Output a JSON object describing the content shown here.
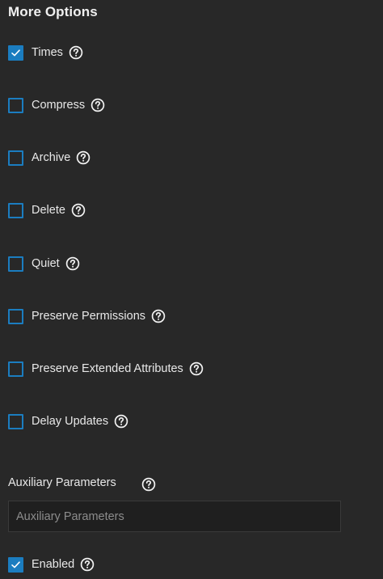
{
  "section": {
    "title": "More Options"
  },
  "options": [
    {
      "label": "Times",
      "checked": true
    },
    {
      "label": "Compress",
      "checked": false
    },
    {
      "label": "Archive",
      "checked": false
    },
    {
      "label": "Delete",
      "checked": false
    },
    {
      "label": "Quiet",
      "checked": false
    },
    {
      "label": "Preserve Permissions",
      "checked": false
    },
    {
      "label": "Preserve Extended Attributes",
      "checked": false
    },
    {
      "label": "Delay Updates",
      "checked": false
    }
  ],
  "auxiliary": {
    "label": "Auxiliary Parameters",
    "placeholder": "Auxiliary Parameters",
    "value": ""
  },
  "enabled": {
    "label": "Enabled",
    "checked": true
  },
  "colors": {
    "background": "#282828",
    "accent": "#1b7dc0",
    "input_background": "#1f1f1f",
    "text": "#e8e8e8"
  },
  "icons": {
    "help": "help-circle-icon",
    "check": "check-icon"
  }
}
